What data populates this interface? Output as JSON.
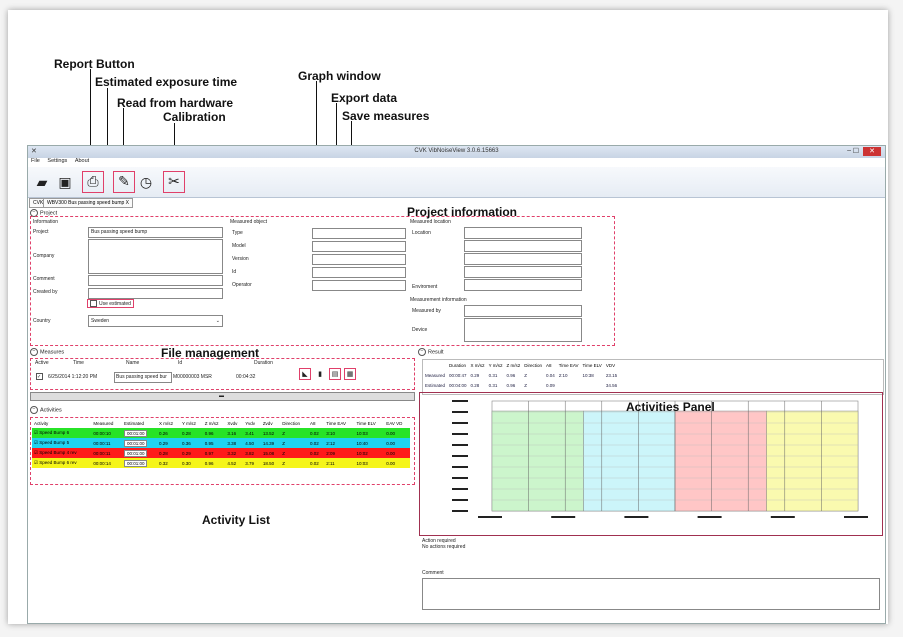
{
  "callouts": {
    "report": "Report Button",
    "estimated": "Estimated exposure time",
    "read": "Read from hardware",
    "calibration": "Calibration",
    "graph": "Graph window",
    "export": "Export data",
    "save": "Save measures",
    "project_info": "Project information",
    "file_mgmt": "File management",
    "activities_panel": "Activities Panel",
    "activity_list": "Activity List"
  },
  "app": {
    "title": "CVK VibNoiseView 3.0.6.15663",
    "menu": [
      "File",
      "Settings",
      "About"
    ],
    "tabs": [
      "CVK",
      "WBV300 Bus passing speed bump  X"
    ]
  },
  "project": {
    "header": "Project",
    "info_header": "Information",
    "project_label": "Project",
    "project_value": "Bus passing speed bump",
    "company_label": "Company",
    "comment_label": "Comment",
    "created_label": "Created by",
    "use_estimated": "Use estimated",
    "country_label": "Country",
    "country_value": "Sweden",
    "mo_header": "Measured object",
    "mo_fields": [
      "Type",
      "Model",
      "Version",
      "Id",
      "Operator"
    ],
    "ml_header": "Measured location",
    "ml_location": "Location",
    "ml_env": "Enviroment",
    "mi_header": "Measurement information",
    "mi_by": "Measured by",
    "mi_device": "Device"
  },
  "measures": {
    "header": "Measures",
    "cols": [
      "Active",
      "Time",
      "Name",
      "Id",
      "Duration"
    ],
    "row": {
      "time": "6/25/2014 1:12:20 PM",
      "name": "Bus passing speed bur",
      "id": "M00000003 MSR",
      "duration": "00:04:32"
    }
  },
  "result": {
    "header": "Result",
    "cols": [
      "Duration",
      "X m/s2",
      "Y m/s2",
      "Z m/s2",
      "Direction",
      "A8",
      "Time EAV",
      "Time ELV",
      "VDV"
    ],
    "rows": [
      {
        "label": "Measured",
        "vals": [
          "00:00:47",
          "0.29",
          "0.31",
          "0.96",
          "Z",
          "0.04",
          "2:10",
          "10:38",
          "23.15"
        ]
      },
      {
        "label": "Estimated",
        "vals": [
          "00:04:00",
          "0.28",
          "0.31",
          "0.96",
          "Z",
          "0.09",
          "",
          "",
          "34.56"
        ]
      }
    ],
    "action_label": "Action required",
    "action_value": "No actions required",
    "comment_label": "Comment"
  },
  "activities": {
    "header": "Activities",
    "cols": [
      "Activity",
      "Measured",
      "Estimated",
      "X m/s2",
      "Y m/s2",
      "Z m/s2",
      "Xvdv",
      "Yvdv",
      "Zvdv",
      "Direction",
      "A8",
      "Time EAV",
      "Time ELV",
      "EAV VD"
    ],
    "rows": [
      {
        "name": "Speed Bump 6",
        "measured": "00:00:10",
        "estimated": "00:01:00",
        "vals": [
          "0.26",
          "0.28",
          "0.96",
          "3.16",
          "3.41",
          "13.52",
          "Z",
          "0.02",
          "3:10",
          "10:03",
          "0.00"
        ],
        "color": "#27e327"
      },
      {
        "name": "Speed Bump 5",
        "measured": "00:00:11",
        "estimated": "00:01:00",
        "vals": [
          "0.29",
          "0.36",
          "0.95",
          "3.38",
          "4.50",
          "14.39",
          "Z",
          "0.02",
          "2:12",
          "10:40",
          "0.00"
        ],
        "color": "#1fd3f0"
      },
      {
        "name": "Speed Bump 4 rev",
        "measured": "00:00:11",
        "estimated": "00:01:00",
        "vals": [
          "0.28",
          "0.29",
          "0.97",
          "3.32",
          "3.82",
          "15.08",
          "Z",
          "0.02",
          "2:09",
          "10:02",
          "0.00"
        ],
        "color": "#ff1a1a"
      },
      {
        "name": "Speed Bump 6 rev",
        "measured": "00:00:14",
        "estimated": "00:01:00",
        "vals": [
          "0.32",
          "0.30",
          "0.96",
          "4.52",
          "3.79",
          "18.50",
          "Z",
          "0.02",
          "2:11",
          "10:03",
          "0.00"
        ],
        "color": "#f5f51a"
      }
    ]
  },
  "chart_data": {
    "type": "bar",
    "series": [
      {
        "color": "#ccf5cc"
      },
      {
        "color": "#ccf5fa"
      },
      {
        "color": "#ffc6c6"
      },
      {
        "color": "#fafaaf"
      }
    ]
  },
  "icons": [
    "open-folder-icon",
    "save-icon",
    "printer-icon",
    "read-hardware-icon",
    "stopwatch-icon",
    "calibration-tools-icon"
  ]
}
